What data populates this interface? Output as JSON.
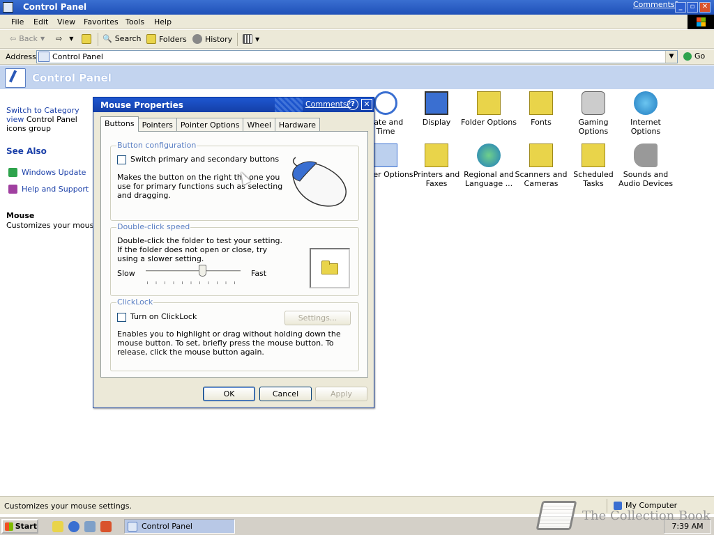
{
  "window": {
    "title": "Control Panel",
    "comments_link": "Comments?",
    "controls": {
      "minimize": "_",
      "maximize": "▫",
      "close": "✕"
    }
  },
  "menubar": {
    "items": [
      "File",
      "Edit",
      "View",
      "Favorites",
      "Tools",
      "Help"
    ]
  },
  "toolbar": {
    "back": "Back",
    "search": "Search",
    "folders": "Folders",
    "history": "History"
  },
  "address": {
    "label": "Address",
    "value": "Control Panel",
    "go": "Go"
  },
  "content": {
    "title": "Control Panel"
  },
  "left_pane": {
    "switch_link": "Switch to Category view",
    "desc": "Control Panel icons group categories.",
    "see_also": "See Also",
    "links": [
      "Windows Update",
      "Help and Support"
    ],
    "selection_title": "Mouse",
    "selection_desc": "Customizes your mouse settings."
  },
  "icons": [
    {
      "label": "Date and Time",
      "color": "#3a6fd1"
    },
    {
      "label": "Display",
      "color": "#3a6fd1"
    },
    {
      "label": "Folder Options",
      "color": "#e9d44a"
    },
    {
      "label": "Fonts",
      "color": "#e9d44a"
    },
    {
      "label": "Gaming Options",
      "color": "#888888"
    },
    {
      "label": "Internet Options",
      "color": "#2ea34c"
    },
    {
      "label": "Power Options",
      "color": "#3a6fd1"
    },
    {
      "label": "Printers and Faxes",
      "color": "#e9d44a"
    },
    {
      "label": "Regional and Language ...",
      "color": "#2ea34c"
    },
    {
      "label": "Scanners and Cameras",
      "color": "#e9d44a"
    },
    {
      "label": "Scheduled Tasks",
      "color": "#e9d44a"
    },
    {
      "label": "Sounds and Audio Devices",
      "color": "#888888"
    }
  ],
  "status": {
    "text": "Customizes your mouse settings.",
    "zone": "My Computer"
  },
  "taskbar": {
    "start": "Start",
    "task": "Control Panel",
    "clock": "7:39 AM"
  },
  "watermark": "The Collection Book",
  "dialog": {
    "title": "Mouse Properties",
    "comments": "Comments?",
    "help": "?",
    "close": "✕",
    "tabs": [
      "Buttons",
      "Pointers",
      "Pointer Options",
      "Wheel",
      "Hardware"
    ],
    "active_tab": "Buttons",
    "button_config": {
      "label": "Button configuration",
      "checkbox": "Switch primary and secondary buttons",
      "checked": false,
      "desc": "Makes the button on the right the one you use for primary functions such as selecting and dragging."
    },
    "double_click": {
      "label": "Double-click speed",
      "desc": "Double-click the folder to test your setting. If the folder does not open or close, try using a slower setting.",
      "slow": "Slow",
      "fast": "Fast",
      "speed_fraction": 0.6
    },
    "clicklock": {
      "label": "ClickLock",
      "checkbox": "Turn on ClickLock",
      "checked": false,
      "settings": "Settings...",
      "desc": "Enables you to highlight or drag without holding down the mouse button. To set, briefly press the mouse button. To release, click the mouse button again."
    },
    "buttons": {
      "ok": "OK",
      "cancel": "Cancel",
      "apply": "Apply"
    }
  }
}
